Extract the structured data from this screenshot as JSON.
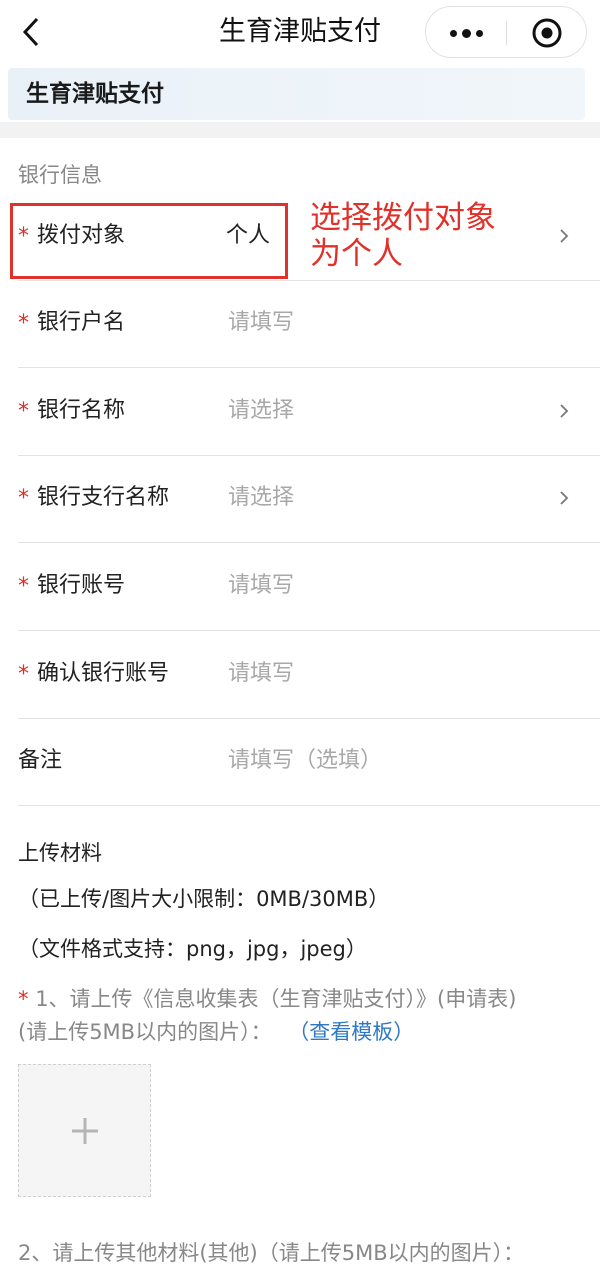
{
  "nav": {
    "title": "生育津贴支付",
    "back_icon": "chevron-left-icon",
    "more_icon": "more-dots-icon",
    "close_icon": "target-close-icon"
  },
  "banner": {
    "title": "生育津贴支付"
  },
  "bank_section": {
    "title": "银行信息"
  },
  "rows": [
    {
      "label": "拨付对象",
      "value": "个人",
      "required": true,
      "placeholder": false,
      "chevron": true
    },
    {
      "label": "银行户名",
      "value": "请填写",
      "required": true,
      "placeholder": true,
      "chevron": false
    },
    {
      "label": "银行名称",
      "value": "请选择",
      "required": true,
      "placeholder": true,
      "chevron": true
    },
    {
      "label": "银行支行名称",
      "value": "请选择",
      "required": true,
      "placeholder": true,
      "chevron": true
    },
    {
      "label": "银行账号",
      "value": "请填写",
      "required": true,
      "placeholder": true,
      "chevron": false
    },
    {
      "label": "确认银行账号",
      "value": "请填写",
      "required": true,
      "placeholder": true,
      "chevron": false
    },
    {
      "label": "备注",
      "value": "请填写（选填）",
      "required": false,
      "placeholder": true,
      "chevron": false
    }
  ],
  "annotation": {
    "line1": "选择拨付对象",
    "line2": "为个人"
  },
  "upload": {
    "title": "上传材料",
    "size_limit": "（已上传/图片大小限制：0MB/30MB）",
    "formats": "（文件格式支持：png，jpg，jpeg）",
    "item1_required_mark": "*",
    "item1_line1": "1、请上传《信息收集表（生育津贴支付）》(申请表)",
    "item1_line2": "(请上传5MB以内的图片）：",
    "item1_link": "（查看模板）",
    "add_symbol": "+",
    "item2_line": "2、请上传其他材料(其他)（请上传5MB以内的图片）："
  },
  "colors": {
    "required": "#d9312b",
    "annotation": "#e0312b",
    "link": "#2f78c4",
    "placeholder": "#a8a8a8"
  }
}
